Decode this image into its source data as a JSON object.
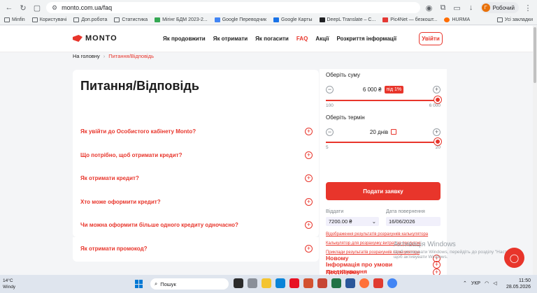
{
  "browser": {
    "url": "monto.com.ua/faq",
    "profile_initial": "Г",
    "profile_name": "Робочий",
    "bookmarks": [
      "Minfin",
      "Користувачі",
      "Доп.робота",
      "Статистика",
      "Мігінг БДМ 2023-2...",
      "Google Переводчик",
      "Google Карты",
      "DeepL Translate – С...",
      "Pic4Net — безкошт...",
      "HURMA"
    ],
    "all_bookmarks": "Усі закладки"
  },
  "header": {
    "logo_text": "MONTO",
    "nav": [
      "Як продовжити",
      "Як отримати",
      "Як погасити",
      "FAQ",
      "Акції",
      "Розкриття інформації"
    ],
    "login_label": "Увійти"
  },
  "breadcrumb": {
    "home": "На головну",
    "separator": "›",
    "current": "Питання/Відповідь"
  },
  "faq": {
    "title": "Питання/Відповідь",
    "items": [
      "Як увійти до Особистого кабінету Monto?",
      "Що потрібно, щоб отримати кредит?",
      "Як отримати кредит?",
      "Хто може оформити кредит?",
      "Чи можна оформити більше одного кредиту одночасно?",
      "Як отримати промокод?"
    ],
    "expand_symbol": "+"
  },
  "calculator": {
    "amount_label": "Оберіть суму",
    "amount_value": "6 000 ₴",
    "amount_badge": "під 1%",
    "amount_min": "100",
    "amount_max": "6 000",
    "amount_fraction": 1.0,
    "term_label": "Оберіть термін",
    "term_value": "20 днів",
    "term_min": "5",
    "term_max": "20",
    "term_fraction": 1.0,
    "minus": "−",
    "plus": "+",
    "submit_label": "Подати заявку",
    "give_label": "Віддати",
    "give_value": "7200.00 ₴",
    "return_label": "Дата повернення",
    "return_value": "16/06/2026",
    "links": [
      "Відображення результатів розрахунків калькулятора",
      "Калькулятор для розрахунку витрат за послугою",
      "Приклади результатів розрахунків калькулятора"
    ],
    "accordion": [
      "Інформація про умови кредитування",
      "Новому",
      "Постійному"
    ]
  },
  "watermark": {
    "title": "Активація Windows",
    "subtitle": "Щоб активувати Windows, перейдіть до розділу \"Настройки\", щоб активувати Windows."
  },
  "taskbar": {
    "temp": "14°C",
    "weather": "Windy",
    "search": "Пошук",
    "lang": "УКР",
    "time": "11:50",
    "date": "28.05.2026"
  }
}
